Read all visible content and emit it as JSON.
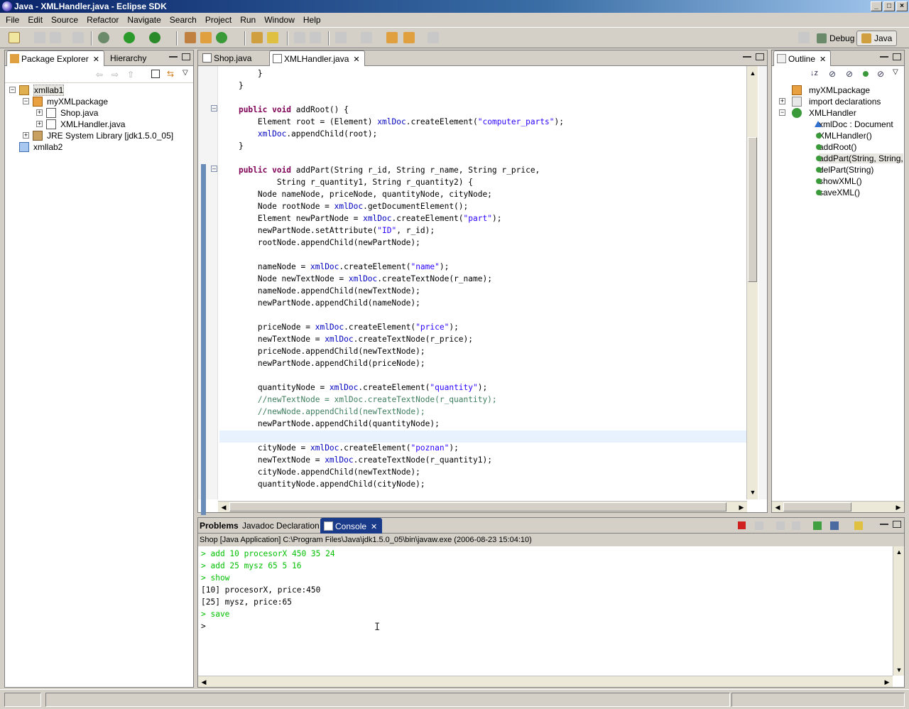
{
  "window": {
    "title": "Java - XMLHandler.java - Eclipse SDK"
  },
  "menu": [
    "File",
    "Edit",
    "Source",
    "Refactor",
    "Navigate",
    "Search",
    "Project",
    "Run",
    "Window",
    "Help"
  ],
  "perspectives": {
    "debug": "Debug",
    "java": "Java"
  },
  "package_explorer": {
    "tabs": [
      "Package Explorer",
      "Hierarchy"
    ],
    "tree": [
      {
        "label": "xmllab1",
        "level": 0,
        "icon": "project-icon",
        "expanded": true
      },
      {
        "label": "myXMLpackage",
        "level": 1,
        "icon": "package-icon",
        "expanded": true
      },
      {
        "label": "Shop.java",
        "level": 2,
        "icon": "java-file-icon",
        "expanded": false
      },
      {
        "label": "XMLHandler.java",
        "level": 2,
        "icon": "java-file-icon",
        "expanded": false
      },
      {
        "label": "JRE System Library [jdk1.5.0_05]",
        "level": 1,
        "icon": "library-icon",
        "expanded": false
      },
      {
        "label": "xmllab2",
        "level": 0,
        "icon": "folder-icon",
        "expanded": false
      }
    ]
  },
  "editor": {
    "tabs": [
      "Shop.java",
      "XMLHandler.java"
    ],
    "active_tab": "XMLHandler.java",
    "lines": [
      [
        [
          "",
          "        }"
        ]
      ],
      [
        [
          "",
          "    }"
        ]
      ],
      [
        [
          "",
          ""
        ]
      ],
      [
        [
          "",
          "    "
        ],
        [
          "kw",
          "public void"
        ],
        [
          "",
          " addRoot() {"
        ]
      ],
      [
        [
          "",
          "        Element root = (Element) "
        ],
        [
          "fld",
          "xmlDoc"
        ],
        [
          "",
          ".createElement("
        ],
        [
          "str",
          "\"computer_parts\""
        ],
        [
          "",
          ");"
        ]
      ],
      [
        [
          "",
          "        "
        ],
        [
          "fld",
          "xmlDoc"
        ],
        [
          "",
          ".appendChild(root);"
        ]
      ],
      [
        [
          "",
          "    }"
        ]
      ],
      [
        [
          "",
          ""
        ]
      ],
      [
        [
          "",
          "    "
        ],
        [
          "kw",
          "public void"
        ],
        [
          "",
          " addPart(String r_id, String r_name, String r_price,"
        ]
      ],
      [
        [
          "",
          "            String r_quantity1, String r_quantity2) {"
        ]
      ],
      [
        [
          "",
          "        Node nameNode, priceNode, quantityNode, cityNode;"
        ]
      ],
      [
        [
          "",
          "        Node rootNode = "
        ],
        [
          "fld",
          "xmlDoc"
        ],
        [
          "",
          ".getDocumentElement();"
        ]
      ],
      [
        [
          "",
          "        Element newPartNode = "
        ],
        [
          "fld",
          "xmlDoc"
        ],
        [
          "",
          ".createElement("
        ],
        [
          "str",
          "\"part\""
        ],
        [
          "",
          ");"
        ]
      ],
      [
        [
          "",
          "        newPartNode.setAttribute("
        ],
        [
          "str",
          "\"ID\""
        ],
        [
          "",
          ", r_id);"
        ]
      ],
      [
        [
          "",
          "        rootNode.appendChild(newPartNode);"
        ]
      ],
      [
        [
          "",
          ""
        ]
      ],
      [
        [
          "",
          "        nameNode = "
        ],
        [
          "fld",
          "xmlDoc"
        ],
        [
          "",
          ".createElement("
        ],
        [
          "str",
          "\"name\""
        ],
        [
          "",
          ");"
        ]
      ],
      [
        [
          "",
          "        Node newTextNode = "
        ],
        [
          "fld",
          "xmlDoc"
        ],
        [
          "",
          ".createTextNode(r_name);"
        ]
      ],
      [
        [
          "",
          "        nameNode.appendChild(newTextNode);"
        ]
      ],
      [
        [
          "",
          "        newPartNode.appendChild(nameNode);"
        ]
      ],
      [
        [
          "",
          ""
        ]
      ],
      [
        [
          "",
          "        priceNode = "
        ],
        [
          "fld",
          "xmlDoc"
        ],
        [
          "",
          ".createElement("
        ],
        [
          "str",
          "\"price\""
        ],
        [
          "",
          ");"
        ]
      ],
      [
        [
          "",
          "        newTextNode = "
        ],
        [
          "fld",
          "xmlDoc"
        ],
        [
          "",
          ".createTextNode(r_price);"
        ]
      ],
      [
        [
          "",
          "        priceNode.appendChild(newTextNode);"
        ]
      ],
      [
        [
          "",
          "        newPartNode.appendChild(priceNode);"
        ]
      ],
      [
        [
          "",
          ""
        ]
      ],
      [
        [
          "",
          "        quantityNode = "
        ],
        [
          "fld",
          "xmlDoc"
        ],
        [
          "",
          ".createElement("
        ],
        [
          "str",
          "\"quantity\""
        ],
        [
          "",
          ");"
        ]
      ],
      [
        [
          "cm",
          "        //newTextNode = xmlDoc.createTextNode(r_quantity);"
        ]
      ],
      [
        [
          "cm",
          "        //newNode.appendChild(newTextNode);"
        ]
      ],
      [
        [
          "",
          "        newPartNode.appendChild(quantityNode);"
        ]
      ],
      [
        [
          "",
          ""
        ]
      ],
      [
        [
          "",
          "        cityNode = "
        ],
        [
          "fld",
          "xmlDoc"
        ],
        [
          "",
          ".createElement("
        ],
        [
          "str",
          "\"poznan\""
        ],
        [
          "",
          ");"
        ]
      ],
      [
        [
          "",
          "        newTextNode = "
        ],
        [
          "fld",
          "xmlDoc"
        ],
        [
          "",
          ".createTextNode(r_quantity1);"
        ]
      ],
      [
        [
          "",
          "        cityNode.appendChild(newTextNode);"
        ]
      ],
      [
        [
          "",
          "        quantityNode.appendChild(cityNode);"
        ]
      ]
    ]
  },
  "outline": {
    "tab": "Outline",
    "tree": [
      {
        "label": "myXMLpackage",
        "level": 0,
        "icon": "package-icon",
        "exp": ""
      },
      {
        "label": "import declarations",
        "level": 0,
        "icon": "import-icon",
        "exp": "+"
      },
      {
        "label": "XMLHandler",
        "level": 0,
        "icon": "class-icon",
        "exp": "-"
      },
      {
        "label": "xmlDoc : Document",
        "level": 1,
        "icon": "field-icon",
        "exp": ""
      },
      {
        "label": "XMLHandler()",
        "level": 1,
        "icon": "constructor-icon",
        "exp": ""
      },
      {
        "label": "addRoot()",
        "level": 1,
        "icon": "method-icon",
        "exp": ""
      },
      {
        "label": "addPart(String, String,",
        "level": 1,
        "icon": "method-icon",
        "exp": "",
        "selected": true
      },
      {
        "label": "delPart(String)",
        "level": 1,
        "icon": "method-icon",
        "exp": ""
      },
      {
        "label": "showXML()",
        "level": 1,
        "icon": "method-icon",
        "exp": ""
      },
      {
        "label": "saveXML()",
        "level": 1,
        "icon": "method-icon",
        "exp": ""
      }
    ]
  },
  "bottom": {
    "tabs": [
      "Problems",
      "Javadoc",
      "Declaration",
      "Console"
    ],
    "active_tab": "Console",
    "console_header": "Shop [Java Application] C:\\Program Files\\Java\\jdk1.5.0_05\\bin\\javaw.exe (2006-08-23 15:04:10)",
    "output": [
      {
        "type": "in",
        "text": "> add 10 procesorX 450 35 24"
      },
      {
        "type": "in",
        "text": "> add 25 mysz 65 5 16"
      },
      {
        "type": "in",
        "text": "> show"
      },
      {
        "type": "out",
        "text": "[10] procesorX, price:450"
      },
      {
        "type": "out",
        "text": "[25] mysz, price:65"
      },
      {
        "type": "in",
        "text": "> save"
      },
      {
        "type": "out",
        "text": ">"
      }
    ]
  },
  "colors": {
    "accent": "#0a246a",
    "keyword": "#7f0055",
    "field": "#0000c0",
    "string": "#2a00ff",
    "comment": "#3f7f5f",
    "console_input": "#00c000"
  }
}
